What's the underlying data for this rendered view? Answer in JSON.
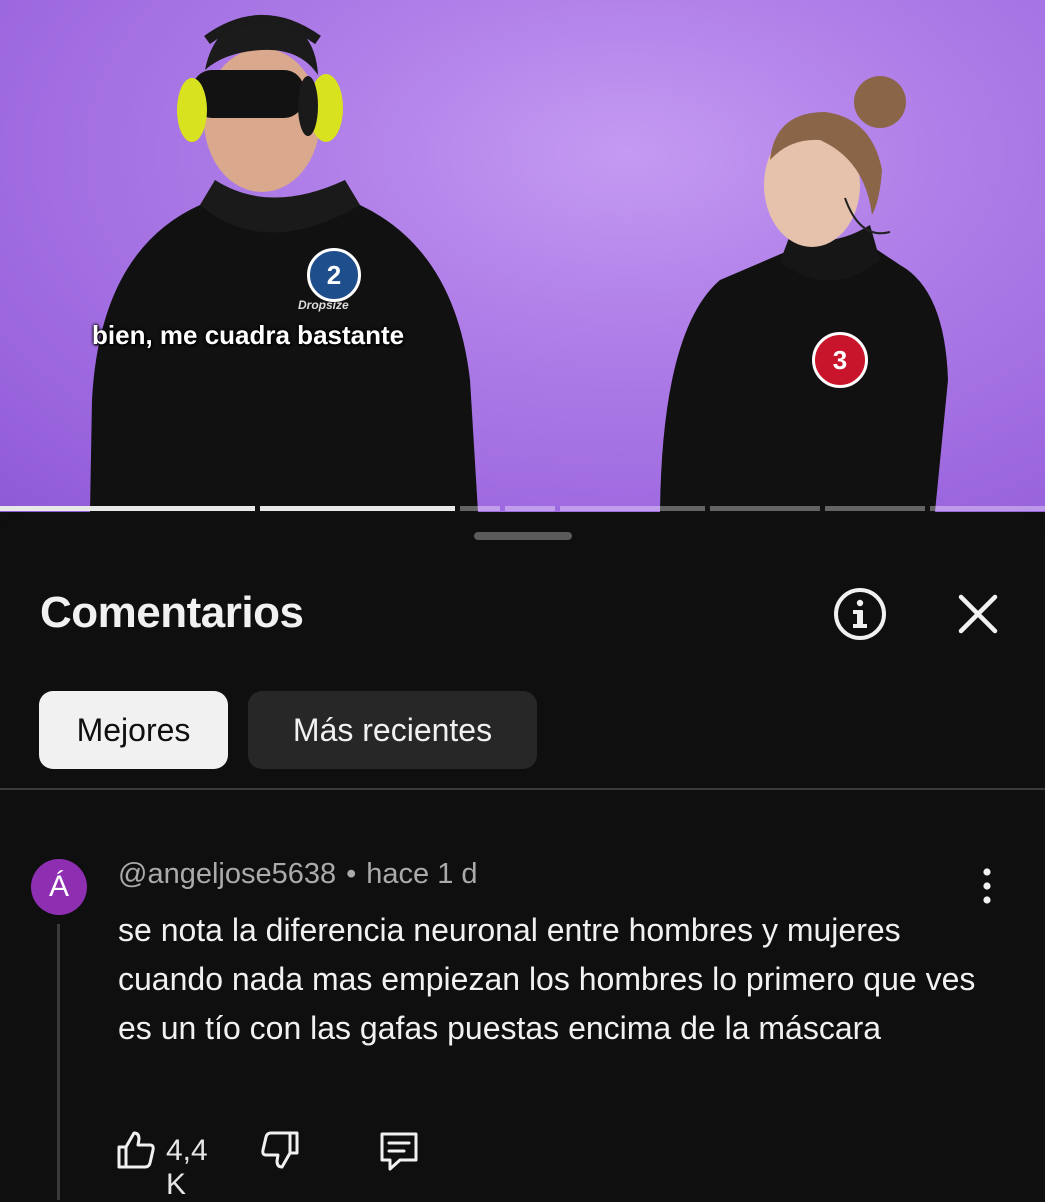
{
  "video": {
    "subtitle": "bien, me cuadra bastante",
    "contestant_left_number": "2",
    "contestant_left_brand": "Dropsize",
    "contestant_right_number": "3",
    "background_color": "#b07fe8"
  },
  "comments": {
    "title": "Comentarios",
    "info_icon": "info-circle-icon",
    "close_icon": "close-icon",
    "sort_tabs": [
      {
        "label": "Mejores",
        "selected": true
      },
      {
        "label": "Más recientes",
        "selected": false
      }
    ]
  },
  "comment": {
    "avatar_letter": "Á",
    "avatar_color": "#8e2fb2",
    "author": "@angeljose5638",
    "separator": "•",
    "time": "hace 1 d",
    "text": "se nota la diferencia neuronal entre hombres y mujeres cuando nada mas empiezan los hombres lo primero que ves es un tío con las gafas puestas encima de la máscara",
    "likes": "4,4 K",
    "like_icon": "thumbs-up-icon",
    "dislike_icon": "thumbs-down-icon",
    "reply_icon": "reply-comment-icon",
    "menu_icon": "more-vertical-icon"
  }
}
